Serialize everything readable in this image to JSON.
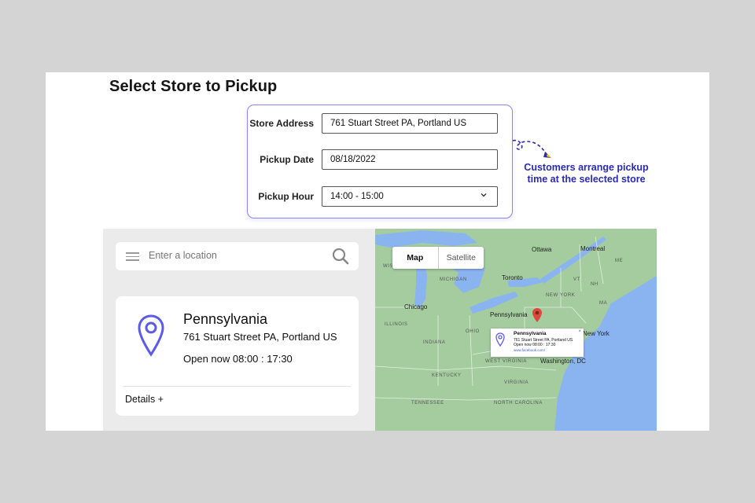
{
  "page": {
    "title": "Select Store to Pickup"
  },
  "form": {
    "store_address_label": "Store Address",
    "store_address_value": "761 Stuart Street PA, Portland US",
    "pickup_date_label": "Pickup Date",
    "pickup_date_value": "08/18/2022",
    "pickup_hour_label": "Pickup Hour",
    "pickup_hour_value": "14:00 - 15:00"
  },
  "annotation": {
    "line1": "Customers arrange pickup",
    "line2": "time at the selected store"
  },
  "search": {
    "placeholder": "Enter a location"
  },
  "store": {
    "name": "Pennsylvania",
    "address": "761 Stuart Street PA, Portland US",
    "hours": "Open now 08:00 : 17:30",
    "details_label": "Details +"
  },
  "map": {
    "tabs": [
      "Map",
      "Satellite"
    ],
    "cities": {
      "ottawa": "Ottawa",
      "montreal": "Montreal",
      "toronto": "Toronto",
      "chicago": "Chicago",
      "pennsylvania": "Pennsylvania",
      "new_york": "New York",
      "washington": "Washington, DC"
    },
    "regions": {
      "wisconsin": "WISCONSIN",
      "michigan": "MICHIGAN",
      "new_york_state": "NEW YORK",
      "vermont": "VT",
      "new_hampshire": "NH",
      "maine": "ME",
      "massachusetts": "MA",
      "illinois": "ILLINOIS",
      "ohio": "OHIO",
      "indiana": "INDIANA",
      "west_virginia": "WEST VIRGINIA",
      "kentucky": "KENTUCKY",
      "virginia": "VIRGINIA",
      "tennessee": "TENNESSEE",
      "north_carolina": "NORTH CAROLINA"
    },
    "popup": {
      "title": "Pennsylvania",
      "address": "761 Stuart Street PA, Portland US",
      "hours": "Open now 08:00 : 17:30",
      "link": "www.facebook.com/",
      "close": "×"
    }
  },
  "icons": {
    "search": "search-icon",
    "menu": "menu-icon",
    "location_pin": "location-pin-icon",
    "map_marker": "map-marker-icon",
    "chevron": "chevron-down-icon",
    "arrow": "curved-arrow-icon"
  },
  "colors": {
    "accent": "#5b5be8",
    "annotation": "#2a2ab0",
    "form_border": "#8a86f0",
    "map_land": "#9ec79a",
    "map_water": "#8ab4f0",
    "marker": "#d94a3d"
  }
}
